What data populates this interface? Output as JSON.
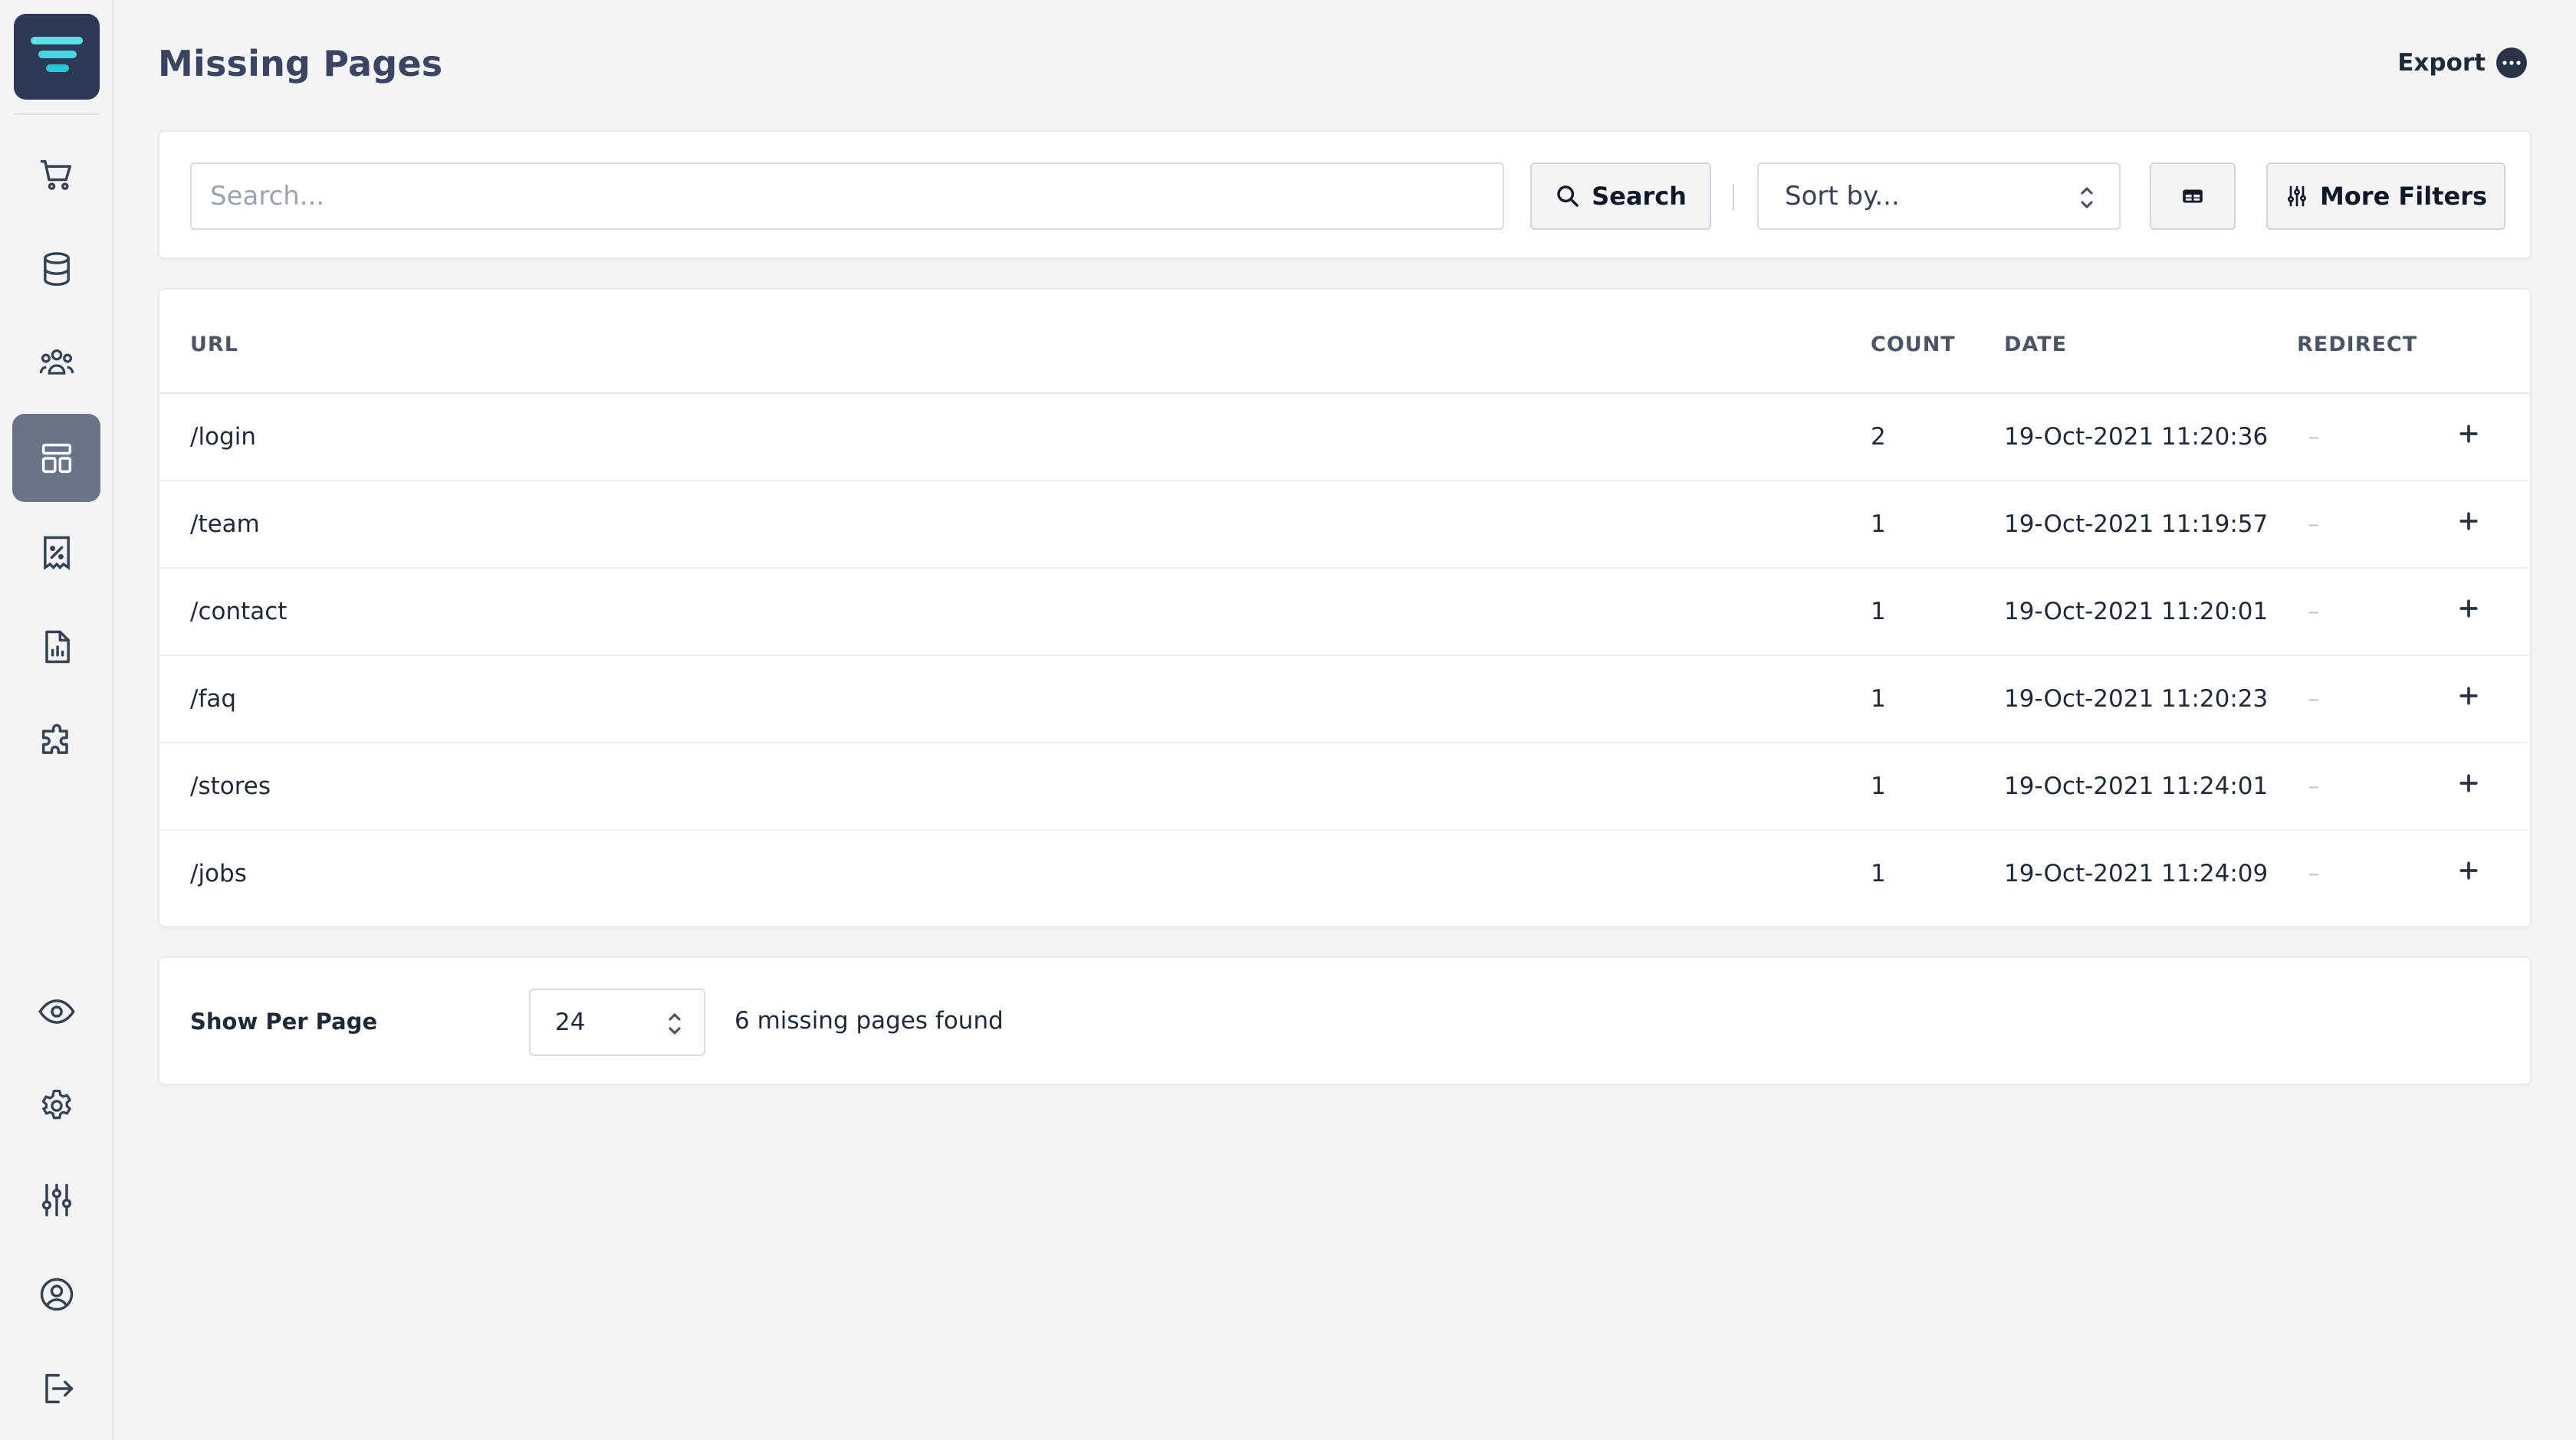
{
  "app": {
    "accent": "#2d3a55",
    "logo_colors": [
      "#5ce1e6",
      "#2ec4d6"
    ]
  },
  "sidebar": {
    "top_items": [
      {
        "icon": "cart-icon",
        "active": false
      },
      {
        "icon": "database-icon",
        "active": false
      },
      {
        "icon": "users-icon",
        "active": false
      },
      {
        "icon": "layout-icon",
        "active": true
      },
      {
        "icon": "discount-receipt-icon",
        "active": false
      },
      {
        "icon": "report-icon",
        "active": false
      },
      {
        "icon": "puzzle-icon",
        "active": false
      }
    ],
    "bottom_items": [
      {
        "icon": "eye-icon"
      },
      {
        "icon": "gear-icon"
      },
      {
        "icon": "sliders-icon"
      },
      {
        "icon": "user-circle-icon"
      },
      {
        "icon": "logout-icon"
      }
    ]
  },
  "header": {
    "title": "Missing Pages",
    "export_label": "Export"
  },
  "filters": {
    "search_placeholder": "Search...",
    "search_value": "",
    "search_button": "Search",
    "sort_placeholder": "Sort by...",
    "more_filters": "More Filters"
  },
  "table": {
    "columns": {
      "url": "URL",
      "count": "COUNT",
      "date": "DATE",
      "redirect": "REDIRECT"
    },
    "rows": [
      {
        "url": "/login",
        "count": "2",
        "date": "19-Oct-2021 11:20:36",
        "redirect": "–"
      },
      {
        "url": "/team",
        "count": "1",
        "date": "19-Oct-2021 11:19:57",
        "redirect": "–"
      },
      {
        "url": "/contact",
        "count": "1",
        "date": "19-Oct-2021 11:20:01",
        "redirect": "–"
      },
      {
        "url": "/faq",
        "count": "1",
        "date": "19-Oct-2021 11:20:23",
        "redirect": "–"
      },
      {
        "url": "/stores",
        "count": "1",
        "date": "19-Oct-2021 11:24:01",
        "redirect": "–"
      },
      {
        "url": "/jobs",
        "count": "1",
        "date": "19-Oct-2021 11:24:09",
        "redirect": "–"
      }
    ]
  },
  "footer": {
    "per_page_label": "Show Per Page",
    "per_page_value": "24",
    "found_text": "6 missing pages found"
  }
}
